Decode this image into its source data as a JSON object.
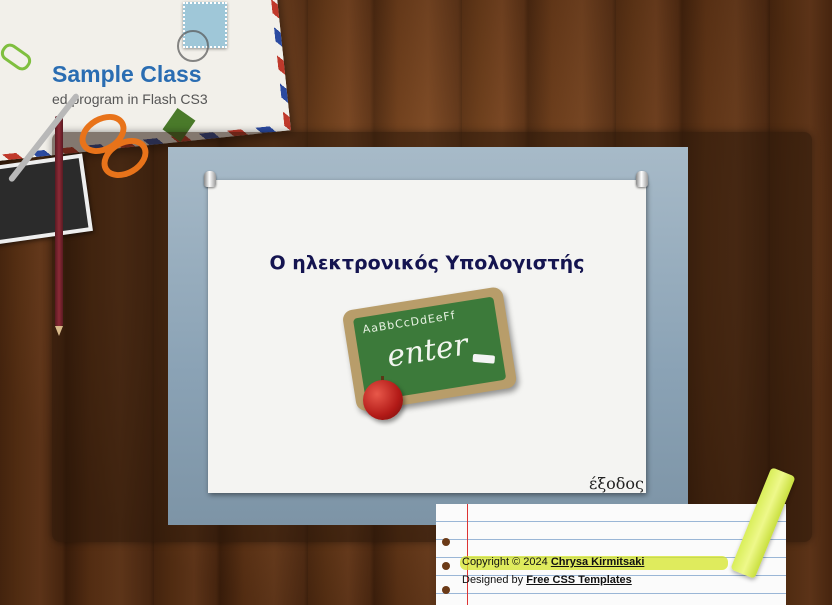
{
  "site": {
    "title": "Sample Class",
    "subtitle": "ed.program in Flash CS3"
  },
  "app": {
    "title": "Ο ηλεκτρονικός Υπολογιστής",
    "board_letters": "AaBbCcDdEeFf",
    "enter_label": "enter",
    "exit_label": "έξοδος"
  },
  "footer": {
    "copyright_prefix": "Copyright © 2024",
    "author": "Chrysa Kirmitsaki",
    "designed_prefix": "Designed by",
    "designer": "Free CSS Templates"
  },
  "colors": {
    "title_blue": "#2a6db2",
    "app_title": "#141450",
    "highlighter": "#d6e628"
  },
  "icons": [
    "stamp-icon",
    "paperclip-icon",
    "scissors-icon",
    "pencil-icon",
    "eraser-icon",
    "pushpin-icon",
    "chalkboard-icon",
    "apple-icon",
    "highlighter-icon"
  ]
}
